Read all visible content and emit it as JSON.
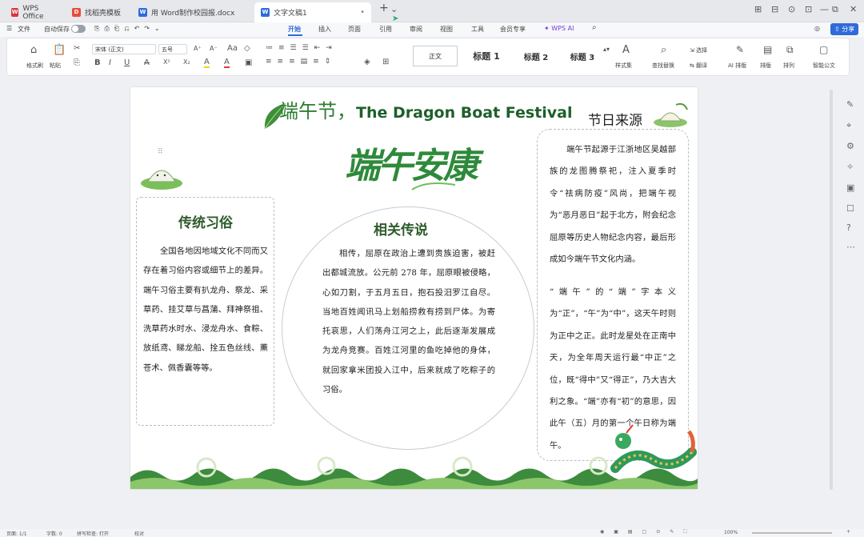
{
  "tabs": [
    {
      "label": "WPS Office",
      "icon": "wps-logo-icon",
      "color": "#d9363e"
    },
    {
      "label": "找稻壳模板",
      "icon": "docer-icon",
      "color": "#e64b3b"
    },
    {
      "label": "用 Word制作校园报.docx",
      "icon": "word-doc-icon",
      "color": "#2f6bd9"
    },
    {
      "label": "文字文稿1",
      "icon": "word-doc-icon",
      "color": "#2f6bd9"
    }
  ],
  "new_tab": "+",
  "tab_dropdown": "⌄",
  "window_controls": [
    "⊞",
    "⊟",
    "⊙",
    "⊡",
    "—",
    "⧉",
    "✕"
  ],
  "menubar": {
    "file": "文件",
    "autosave": "自动保存",
    "items": [
      "开始",
      "插入",
      "页面",
      "引用",
      "审阅",
      "视图",
      "工具",
      "会员专享",
      "WPS AI"
    ],
    "active": "开始",
    "share": "分享"
  },
  "ribbon": {
    "format_painter": "格式刷",
    "paste": "粘贴",
    "font_name": "宋体 (正文)",
    "font_size": "五号",
    "font_grow": "A⁺",
    "font_shrink": "A⁻",
    "clear_format": "◇",
    "bold": "B",
    "italic": "I",
    "underline": "U",
    "strike": "A",
    "superscript": "X²",
    "subscript": "X₂",
    "font_color": "A",
    "highlight": "A",
    "styles": [
      "正文",
      "标题 1",
      "标题 2",
      "标题 3"
    ],
    "styleset": "样式集",
    "find_replace": "查找替换",
    "select": "选择",
    "translate": "翻译",
    "ai_layout": "AI 排版",
    "layout": "排版",
    "arrange": "排列",
    "smart_doc": "智能公文"
  },
  "document": {
    "header_title": "端午节，",
    "header_title_en": "The Dragon Boat Festival",
    "calligraphy": "端午安康",
    "left": {
      "title": "传统习俗",
      "text": "全国各地因地域文化不同而又存在着习俗内容或细节上的差异。端午习俗主要有扒龙舟、祭龙、采草药、挂艾草与菖蒲、拜神祭祖、洗草药水时水、浸龙舟水、食粽、放纸鸢、睇龙船、拴五色丝线、薰苍术、佩香囊等等。"
    },
    "center": {
      "title": "相关传说",
      "text": "相传，屈原在政治上遭到贵族迫害，被赶出都城流放。公元前 278 年，屈原眼被侵略，心如刀割，于五月五日，抱石投汨罗江自尽。当地百姓闻讯马上划船捞救有捞到尸体。为寄托哀思，人们荡舟江河之上，此后逐渐发展成为龙舟竞赛。百姓江河里的鱼吃掉他的身体，就回家拿米团投入江中，后来就成了吃粽子的习俗。"
    },
    "right": {
      "title": "节日来源",
      "p1": "端午节起源于江浙地区吴越部族的龙图腾祭祀，注入夏季时令“祛病防疫”风尚，把端午视为“恶月恶日”起于北方，附会纪念屈原等历史人物纪念内容，最后形成如今端午节文化内涵。",
      "p2": "“端午”的“端”字本义为“正”，“午”为“中”，这天午时则为正中之正。此时龙星处在正南中天，为全年周天运行最“中正”之位，既“得中”又“得正”，乃大吉大利之象。“端”亦有“初”的意思，因此午（五）月的第一个午日称为端午。"
    }
  },
  "status": {
    "page": "页面: 1/1",
    "words": "字数: 0",
    "spell": "拼写检查: 打开",
    "proof": "校对",
    "zoom": "100%"
  },
  "colors": {
    "accent": "#2f6bd9",
    "green": "#2e7d32",
    "title_green": "#2e5b2b"
  }
}
